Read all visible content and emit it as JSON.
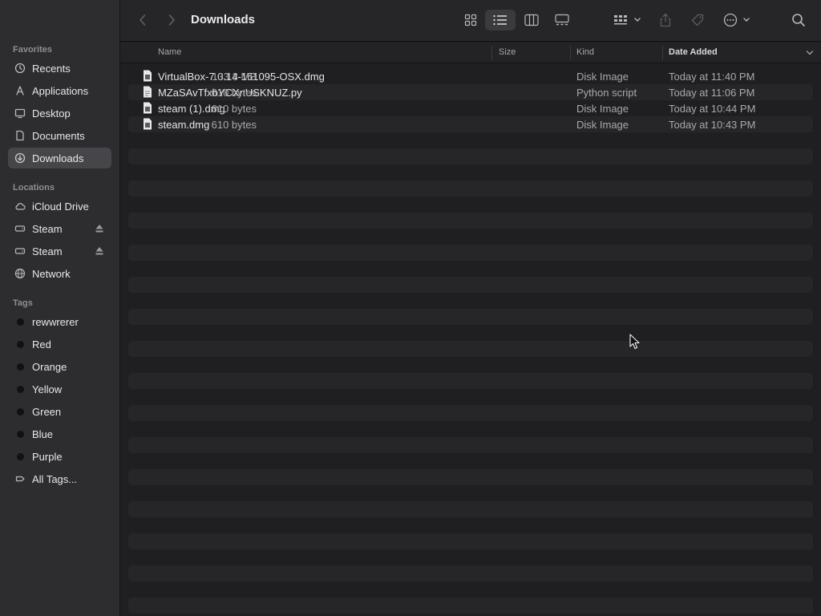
{
  "window": {
    "title": "Downloads"
  },
  "sidebar": {
    "favorites_header": "Favorites",
    "favorites": [
      {
        "label": "Recents",
        "icon": "clock-icon",
        "selected": false
      },
      {
        "label": "Applications",
        "icon": "applications-icon",
        "selected": false
      },
      {
        "label": "Desktop",
        "icon": "desktop-icon",
        "selected": false
      },
      {
        "label": "Documents",
        "icon": "document-icon",
        "selected": false
      },
      {
        "label": "Downloads",
        "icon": "download-icon",
        "selected": true
      }
    ],
    "locations_header": "Locations",
    "locations": [
      {
        "label": "iCloud Drive",
        "icon": "cloud-icon"
      },
      {
        "label": "Steam",
        "icon": "drive-icon",
        "eject": true
      },
      {
        "label": "Steam",
        "icon": "drive-icon",
        "eject": true
      },
      {
        "label": "Network",
        "icon": "globe-icon"
      }
    ],
    "tags_header": "Tags",
    "tags": [
      {
        "label": "rewwrerer",
        "color": "#111111"
      },
      {
        "label": "Red",
        "color": "#111111"
      },
      {
        "label": "Orange",
        "color": "#111111"
      },
      {
        "label": "Yellow",
        "color": "#111111"
      },
      {
        "label": "Green",
        "color": "#111111"
      },
      {
        "label": "Blue",
        "color": "#111111"
      },
      {
        "label": "Purple",
        "color": "#111111"
      },
      {
        "label": "All Tags...",
        "icon": "all-tags-icon"
      }
    ]
  },
  "columns": {
    "name": "Name",
    "size": "Size",
    "kind": "Kind",
    "date_added": "Date Added"
  },
  "files": [
    {
      "name": "VirtualBox-7.0.14-161095-OSX.dmg",
      "size": "133.3 MB",
      "kind": "Disk Image",
      "date_added": "Today at 11:40 PM"
    },
    {
      "name": "MZaSAvTfxbYCXnUSKNUZ.py",
      "size": "610 bytes",
      "kind": "Python script",
      "date_added": "Today at 11:06 PM"
    },
    {
      "name": "steam (1).dmg",
      "size": "610 bytes",
      "kind": "Disk Image",
      "date_added": "Today at 10:44 PM"
    },
    {
      "name": "steam.dmg",
      "size": "610 bytes",
      "kind": "Disk Image",
      "date_added": "Today at 10:43 PM"
    }
  ]
}
